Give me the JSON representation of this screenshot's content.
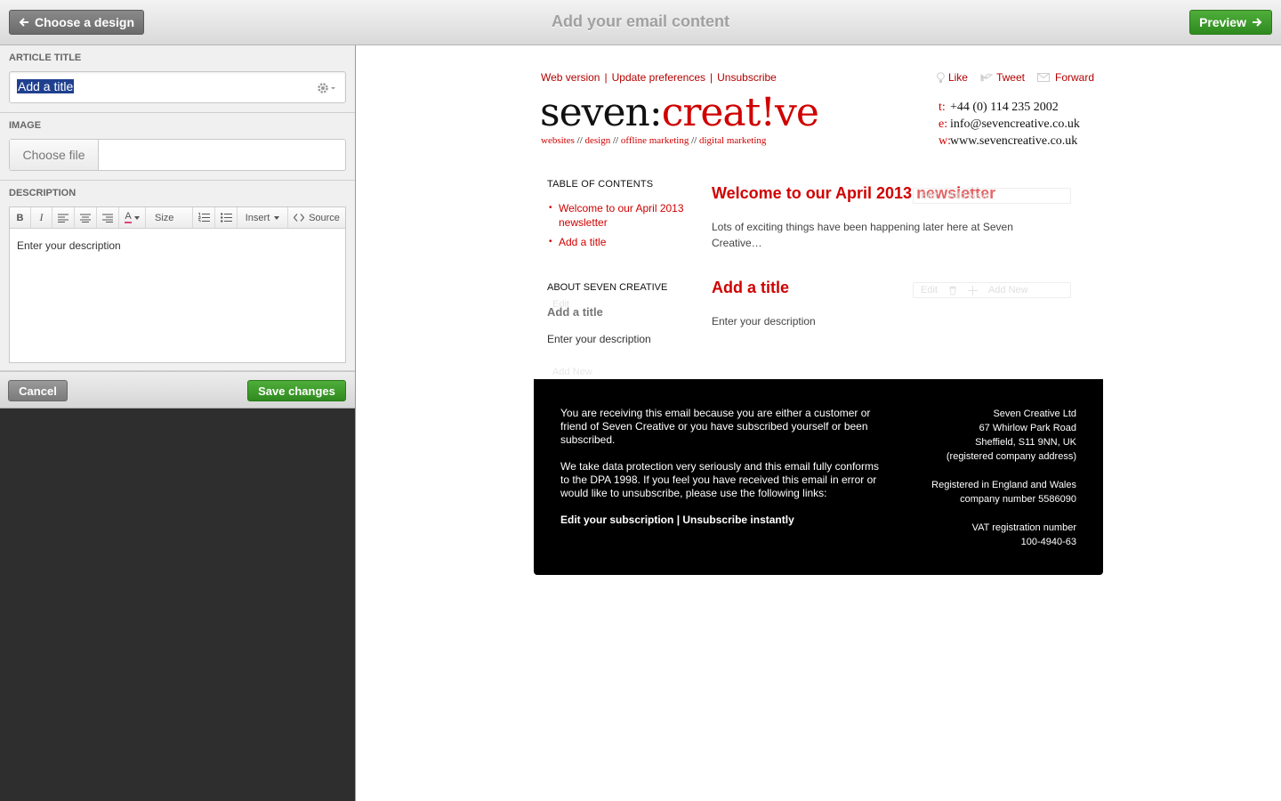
{
  "topbar": {
    "back_label": "Choose a design",
    "title": "Add your email content",
    "preview_label": "Preview"
  },
  "form": {
    "article_title": {
      "label": "ARTICLE TITLE",
      "value": "Add a title"
    },
    "image": {
      "label": "IMAGE",
      "choose_label": "Choose file"
    },
    "description": {
      "label": "DESCRIPTION",
      "toolbar": {
        "bold": "B",
        "italic": "I",
        "color": "A",
        "size": "Size",
        "insert": "Insert",
        "source": "Source"
      },
      "value": "Enter your description"
    },
    "cancel_label": "Cancel",
    "save_label": "Save changes"
  },
  "email": {
    "links": [
      "Web version",
      "Update preferences",
      "Unsubscribe"
    ],
    "social": [
      "Like",
      "Tweet",
      "Forward"
    ],
    "logo": {
      "a": "seven:",
      "b": "creat!ve"
    },
    "tagline": [
      "websites",
      "design",
      "offline marketing",
      "digital marketing"
    ],
    "tagline_sep": "//",
    "contact": {
      "t_key": "t:",
      "t": "+44 (0) 114 235 2002",
      "e_key": "e:",
      "e": "info@sevencreative.co.uk",
      "w_key": "w:",
      "w": "www.sevencreative.co.uk"
    },
    "toc": {
      "heading": "TABLE OF CONTENTS",
      "items": [
        "Welcome to our April 2013 newsletter",
        "Add a title"
      ]
    },
    "about": {
      "heading": "ABOUT SEVEN CREATIVE",
      "edit": "Edit",
      "add_new": "Add New",
      "title": "Add a title",
      "description": "Enter your description"
    },
    "articles": [
      {
        "title": "Welcome to our April 2013 newsletter",
        "body": "Lots of exciting things have been happening later here at Seven Creative…",
        "tools": {
          "edit": "Edit",
          "add_new": "Add New"
        }
      },
      {
        "title": "Add a title",
        "body": "Enter your description",
        "tools": {
          "edit": "Edit",
          "add_new": "Add New"
        }
      }
    ],
    "footer": {
      "p1": "You are receiving this email because you are either a customer or friend of Seven Creative or you have subscribed yourself or been subscribed.",
      "p2": "We take data protection very seriously and this email fully conforms to the DPA 1998. If you feel you have received this email in error or would like to unsubscribe, please use the following links:",
      "edit_sub": "Edit your subscription",
      "link_sep": "|",
      "unsub": "Unsubscribe instantly",
      "company": "Seven Creative Ltd",
      "addr1": "67 Whirlow Park Road",
      "addr2": "Sheffield, S11 9NN, UK",
      "addr3": "(registered company address)",
      "reg1": "Registered in England and Wales",
      "reg2": "company number 5586090",
      "vat1": "VAT registration number",
      "vat2": "100-4940-63"
    }
  },
  "colors": {
    "accent_red": "#d00000",
    "green": "#3a9a28"
  }
}
